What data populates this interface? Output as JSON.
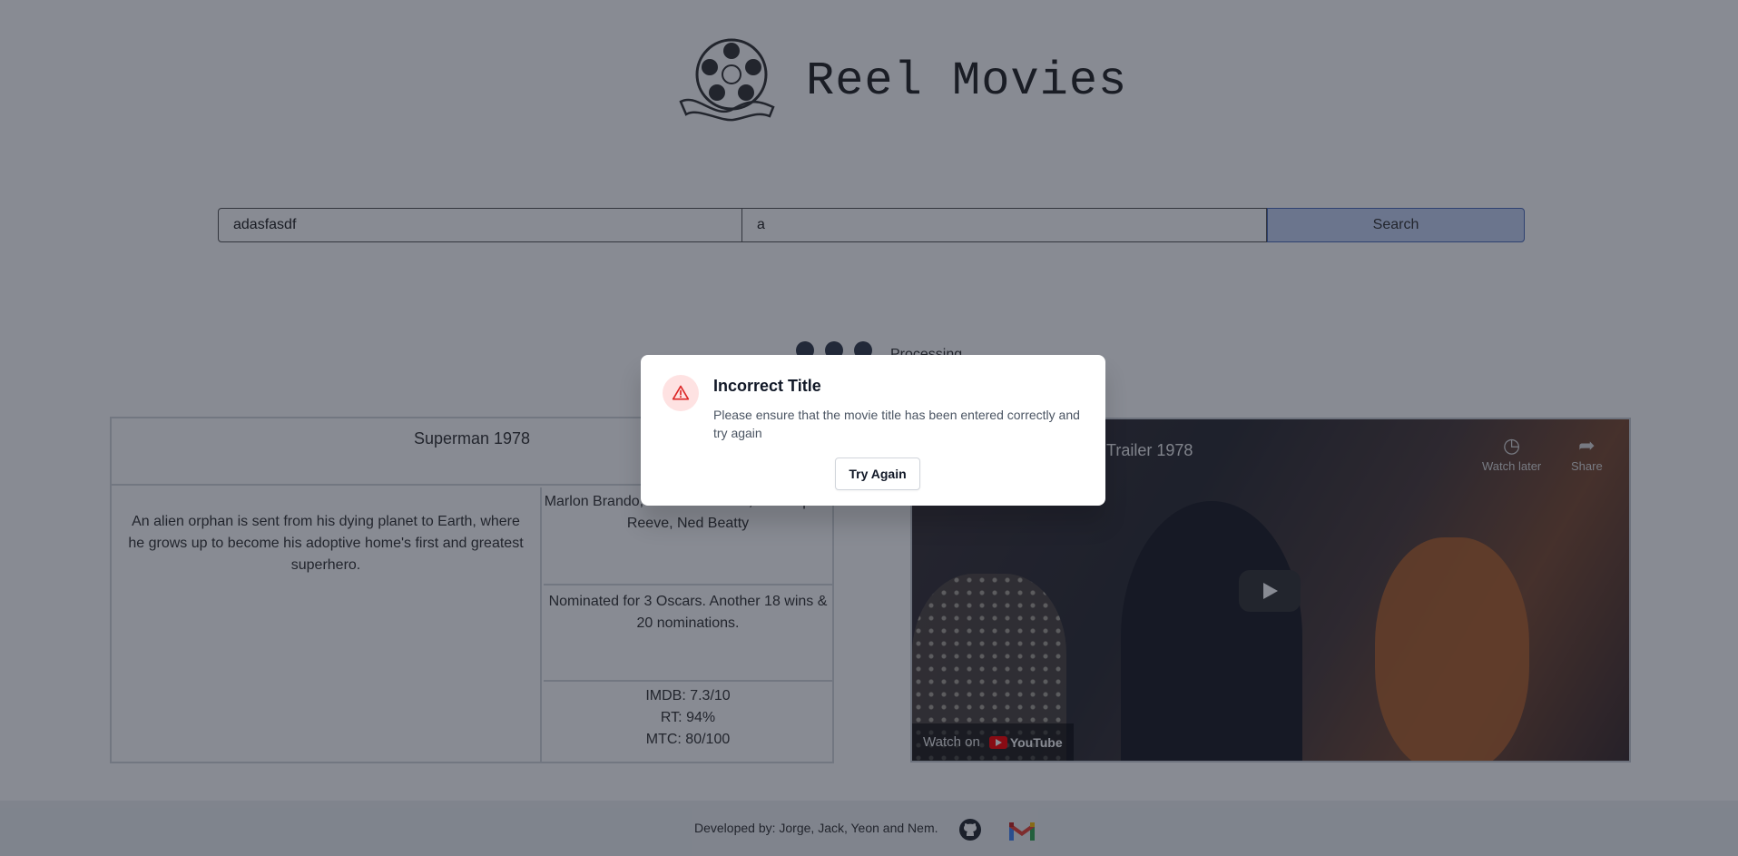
{
  "header": {
    "title": "Reel Movies",
    "logo_icon": "film-reel-icon"
  },
  "search": {
    "title_value": "adasfasdf",
    "year_value": "a",
    "button_label": "Search"
  },
  "status": {
    "processing_text": "Processing"
  },
  "movie": {
    "title": "Superman 1978",
    "plot": "An alien orphan is sent from his dying planet to Earth, where he grows up to become his adoptive home's first and greatest superhero.",
    "actors": "Marlon Brando, Gene Hackman, Christopher Reeve, Ned Beatty",
    "awards": "Nominated for 3 Oscars. Another 18 wins & 20 nominations.",
    "ratings": {
      "imdb": "IMDB: 7.3/10",
      "rt": "RT: 94%",
      "mtc": "MTC: 80/100"
    }
  },
  "video": {
    "title_fragment": "Trailer 1978",
    "watch_later": "Watch later",
    "share": "Share",
    "watch_on": "Watch on",
    "youtube": "YouTube"
  },
  "footer": {
    "credits": "Developed by: Jorge, Jack, Yeon and Nem.",
    "github_icon": "github-icon",
    "gmail_icon": "gmail-icon"
  },
  "modal": {
    "title": "Incorrect Title",
    "body": "Please ensure that the movie title has been entered correctly and try again",
    "button_label": "Try Again",
    "icon": "warning-icon",
    "colors": {
      "icon_bg": "#fee2e2",
      "icon_fg": "#dc2626"
    }
  }
}
